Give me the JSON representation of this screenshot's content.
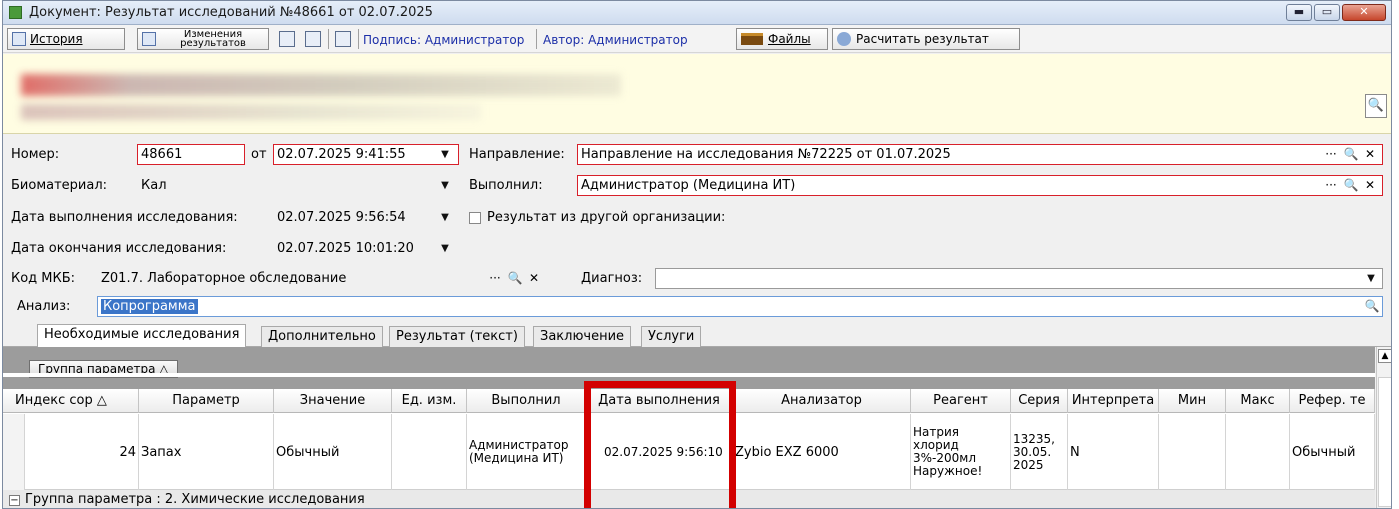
{
  "window": {
    "title": "Документ: Результат исследований №48661 от 02.07.2025",
    "min": "▬",
    "max": "▭",
    "close": "✕"
  },
  "toolbar": {
    "history": "История",
    "changes_line1": "Изменения",
    "changes_line2": "результатов",
    "signature": "Подпись: Администратор",
    "author": "Автор: Администратор",
    "files": "Файлы",
    "calc": "Расчитать результат"
  },
  "icons": {
    "search": "🔍",
    "dropdown": "▼",
    "dots": "···",
    "clear": "✕"
  },
  "form": {
    "number_label": "Номер:",
    "number_value": "48661",
    "from_label": "от",
    "from_value": "02.07.2025 9:41:55",
    "direction_label": "Направление:",
    "direction_value": "Направление на исследования №72225 от 01.07.2025",
    "biomaterial_label": "Биоматериал:",
    "biomaterial_value": "Кал",
    "performed_label": "Выполнил:",
    "performed_value": "Администратор (Медицина ИТ)",
    "date_exec_label": "Дата выполнения исследования:",
    "date_exec_value": "02.07.2025 9:56:54",
    "other_org_label": "Результат из другой организации:",
    "date_end_label": "Дата окончания исследования:",
    "date_end_value": "02.07.2025 10:01:20",
    "mkb_label": "Код МКБ:",
    "mkb_value": "Z01.7. Лабораторное обследование",
    "diagnosis_label": "Диагноз:",
    "diagnosis_value": "",
    "analysis_label": "Анализ:",
    "analysis_value": "Копрограмма"
  },
  "tabs": [
    "Необходимые исследования",
    "Дополнительно",
    "Результат (текст)",
    "Заключение",
    "Услуги"
  ],
  "grid": {
    "group_chip": "Группа параметра  △",
    "columns": [
      "Индекс сор △",
      "Параметр",
      "Значение",
      "Ед. изм.",
      "Выполнил",
      "Дата выполнения",
      "Анализатор",
      "Реагент",
      "Серия",
      "Интерпрета",
      "Мин",
      "Макс",
      "Рефер. те"
    ],
    "row": {
      "index": "24",
      "param": "Запах",
      "value": "Обычный",
      "unit": "",
      "performed": "Администратор (Медицина ИТ)",
      "date": "02.07.2025 9:56:10",
      "analyzer": "Zybio EXZ 6000",
      "reagent": "Натрия хлорид 3%-200мл Наружное!",
      "series": "13235, 30.05. 2025",
      "interp": "N",
      "min": "",
      "max": "",
      "ref": "Обычный"
    },
    "group2": "Группа параметра : 2. Химические исследования",
    "group2_toggle": "−"
  }
}
